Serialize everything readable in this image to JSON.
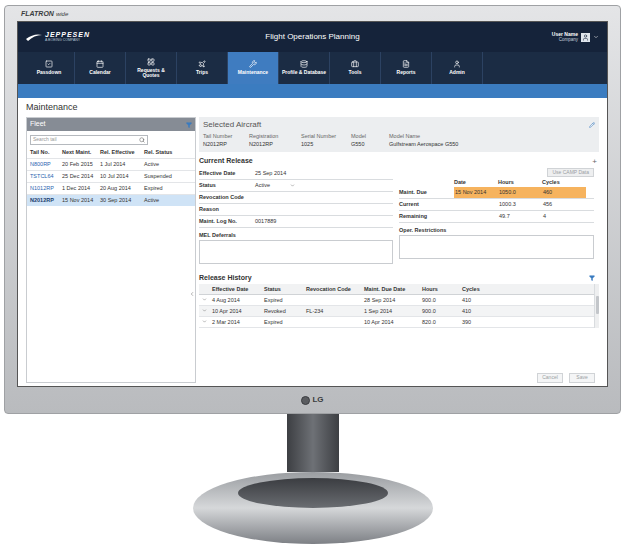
{
  "monitor": {
    "brand": "FLATRON",
    "model": "wide",
    "logo": "LG"
  },
  "header": {
    "logo": "JEPPESEN",
    "logo_sub": "A BOEING COMPANY",
    "title": "Flight Operations Planning",
    "user": "User Name",
    "company": "Company"
  },
  "tabs": [
    {
      "label": "Passdown",
      "selected": false
    },
    {
      "label": "Calendar",
      "selected": false
    },
    {
      "label": "Requests & Quotes",
      "selected": false
    },
    {
      "label": "Trips",
      "selected": false
    },
    {
      "label": "Maintenance",
      "selected": true
    },
    {
      "label": "Profile & Database",
      "selected": false
    },
    {
      "label": "Tools",
      "selected": false
    },
    {
      "label": "Reports",
      "selected": false
    },
    {
      "label": "Admin",
      "selected": false
    }
  ],
  "page_title": "Maintenance",
  "fleet": {
    "title": "Fleet",
    "search_placeholder": "Search tail",
    "columns": [
      "Tail No.",
      "Next Maint.",
      "Rel. Effective",
      "Rel. Status"
    ],
    "rows": [
      {
        "cells": [
          "N800RP",
          "20 Feb 2015",
          "1 Jul 2014",
          "Active"
        ],
        "selected": false
      },
      {
        "cells": [
          "TSTCL64",
          "25 Dec 2014",
          "10 Jul 2014",
          "Suspended"
        ],
        "selected": false
      },
      {
        "cells": [
          "N1012RP",
          "1 Dec 2014",
          "20 Aug 2014",
          "Expired"
        ],
        "selected": false
      },
      {
        "cells": [
          "N2012RP",
          "15 Nov 2014",
          "30 Sep 2014",
          "Active"
        ],
        "selected": true
      }
    ]
  },
  "selected_aircraft": {
    "title": "Selected Aircraft",
    "fields": [
      {
        "label": "Tail Number",
        "value": "N2012RP"
      },
      {
        "label": "Registration",
        "value": "N2012RP"
      },
      {
        "label": "Serial Number",
        "value": "1025"
      },
      {
        "label": "Model",
        "value": "G550"
      },
      {
        "label": "Model Name",
        "value": "Gulfstream Aerospace G550"
      }
    ]
  },
  "current_release": {
    "title": "Current Release",
    "add": "+",
    "fields": [
      {
        "label": "Effective Date",
        "value": "25 Sep 2014",
        "kind": "text"
      },
      {
        "label": "Status",
        "value": "Active",
        "kind": "select"
      },
      {
        "label": "Revocation Code",
        "value": "",
        "kind": "text"
      },
      {
        "label": "Reason",
        "value": "",
        "kind": "text"
      },
      {
        "label": "Maint. Log No.",
        "value": "0017889",
        "kind": "text"
      }
    ],
    "mel_label": "MEL Deferrals",
    "camp_button": {
      "label": "Use CAMP Data",
      "disabled": true
    },
    "due_columns": [
      "Date",
      "Hours",
      "Cycles"
    ],
    "due_rows": [
      {
        "label": "Maint. Due",
        "date": "15 Nov 2014",
        "hours": "1050.0",
        "cycles": "460",
        "highlighted": true
      },
      {
        "label": "Current",
        "date": "",
        "hours": "1000.3",
        "cycles": "456",
        "highlighted": false
      },
      {
        "label": "Remaining",
        "date": "",
        "hours": "49.7",
        "cycles": "4",
        "highlighted": false
      }
    ],
    "restrictions_label": "Oper. Restrictions"
  },
  "release_history": {
    "title": "Release History",
    "columns": [
      "Effective Date",
      "Status",
      "Revocation Code",
      "Maint. Due Date",
      "Hours",
      "Cycles"
    ],
    "rows": [
      {
        "cells": [
          "4 Aug 2014",
          "Expired",
          "",
          "28 Sep 2014",
          "900.0",
          "410"
        ],
        "expanded": false
      },
      {
        "cells": [
          "10 Apr 2014",
          "Revoked",
          "FL-234",
          "1 Sep 2014",
          "900.0",
          "410"
        ],
        "expanded": false
      },
      {
        "cells": [
          "2 Mar 2014",
          "Expired",
          "",
          "10 Apr 2014",
          "820.0",
          "390"
        ],
        "expanded": false
      }
    ]
  },
  "buttons": [
    {
      "label": "Cancel",
      "disabled": true
    },
    {
      "label": "Save",
      "disabled": true
    }
  ]
}
